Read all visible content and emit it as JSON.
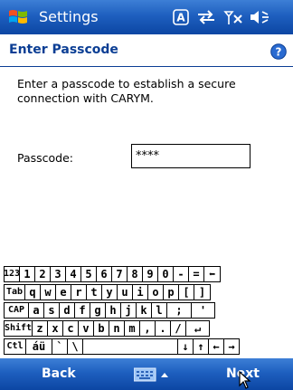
{
  "titlebar": {
    "title": "Settings",
    "icons": [
      "windows-start-flag",
      "input-mode-a-icon",
      "connectivity-icon",
      "no-signal-icon",
      "speaker-volume-icon"
    ]
  },
  "header": {
    "title": "Enter Passcode",
    "help_icon": "help-icon"
  },
  "main": {
    "instructions": "Enter a passcode to establish a secure connection with CARYM.",
    "passcode_label": "Passcode:",
    "passcode_value": "****"
  },
  "keyboard": {
    "rows": [
      [
        "123",
        "1",
        "2",
        "3",
        "4",
        "5",
        "6",
        "7",
        "8",
        "9",
        "0",
        "-",
        "=",
        "⬅"
      ],
      [
        "Tab",
        "q",
        "w",
        "e",
        "r",
        "t",
        "y",
        "u",
        "i",
        "o",
        "p",
        "[",
        "]"
      ],
      [
        "CAP",
        "a",
        "s",
        "d",
        "f",
        "g",
        "h",
        "j",
        "k",
        "l",
        ";",
        "'"
      ],
      [
        "Shift",
        "z",
        "x",
        "c",
        "v",
        "b",
        "n",
        "m",
        ",",
        ".",
        "/",
        "↵"
      ],
      [
        "Ctl",
        "áü",
        "`",
        "\\",
        " ",
        "↓",
        "↑",
        "←",
        "→"
      ]
    ]
  },
  "bottombar": {
    "left_label": "Back",
    "right_label": "Next",
    "keyboard_toggle_icon": "keyboard-icon"
  },
  "colors": {
    "bar_blue": "#1e5fbf",
    "header_text": "#0b3e94"
  }
}
